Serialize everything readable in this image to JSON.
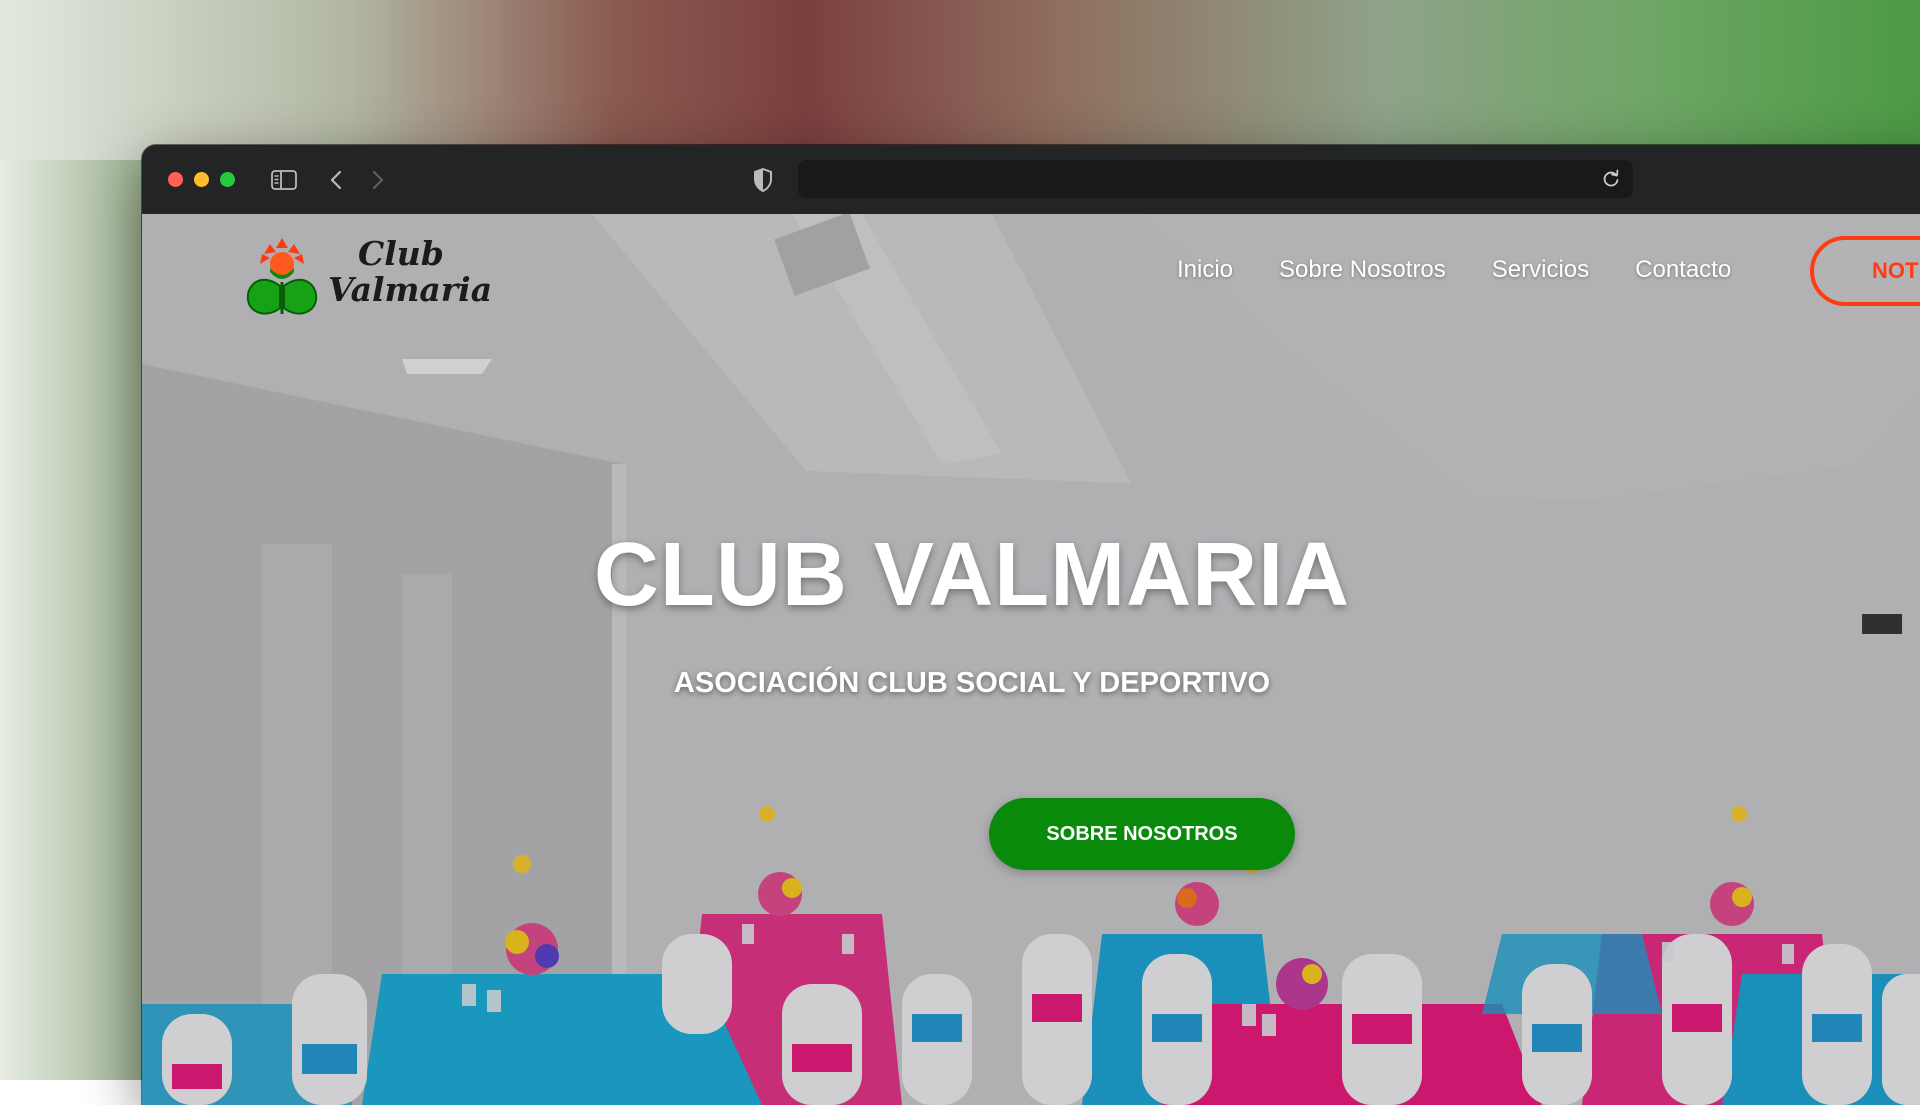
{
  "browser": {
    "url": "",
    "icons": {
      "sidebar": "sidebar-icon",
      "back": "chevron-left-icon",
      "forward": "chevron-right-icon",
      "privacy": "shield-icon",
      "reload": "reload-icon"
    }
  },
  "site": {
    "logo": {
      "line1": "Club",
      "line2": "Valmaria",
      "emblem": "flower-emblem-icon"
    },
    "nav": {
      "items": [
        {
          "label": "Inicio"
        },
        {
          "label": "Sobre Nosotros"
        },
        {
          "label": "Servicios"
        },
        {
          "label": "Contacto"
        }
      ],
      "cta_label": "NOT"
    },
    "hero": {
      "title": "CLUB VALMARIA",
      "subtitle": "ASOCIACIÓN CLUB SOCIAL Y DEPORTIVO",
      "button_label": "SOBRE NOSOTROS"
    }
  },
  "colors": {
    "accent_green": "#0a8a0a",
    "cta_orange": "#ff3b14",
    "table_pink": "#f0147c",
    "table_blue": "#16a7d9"
  }
}
